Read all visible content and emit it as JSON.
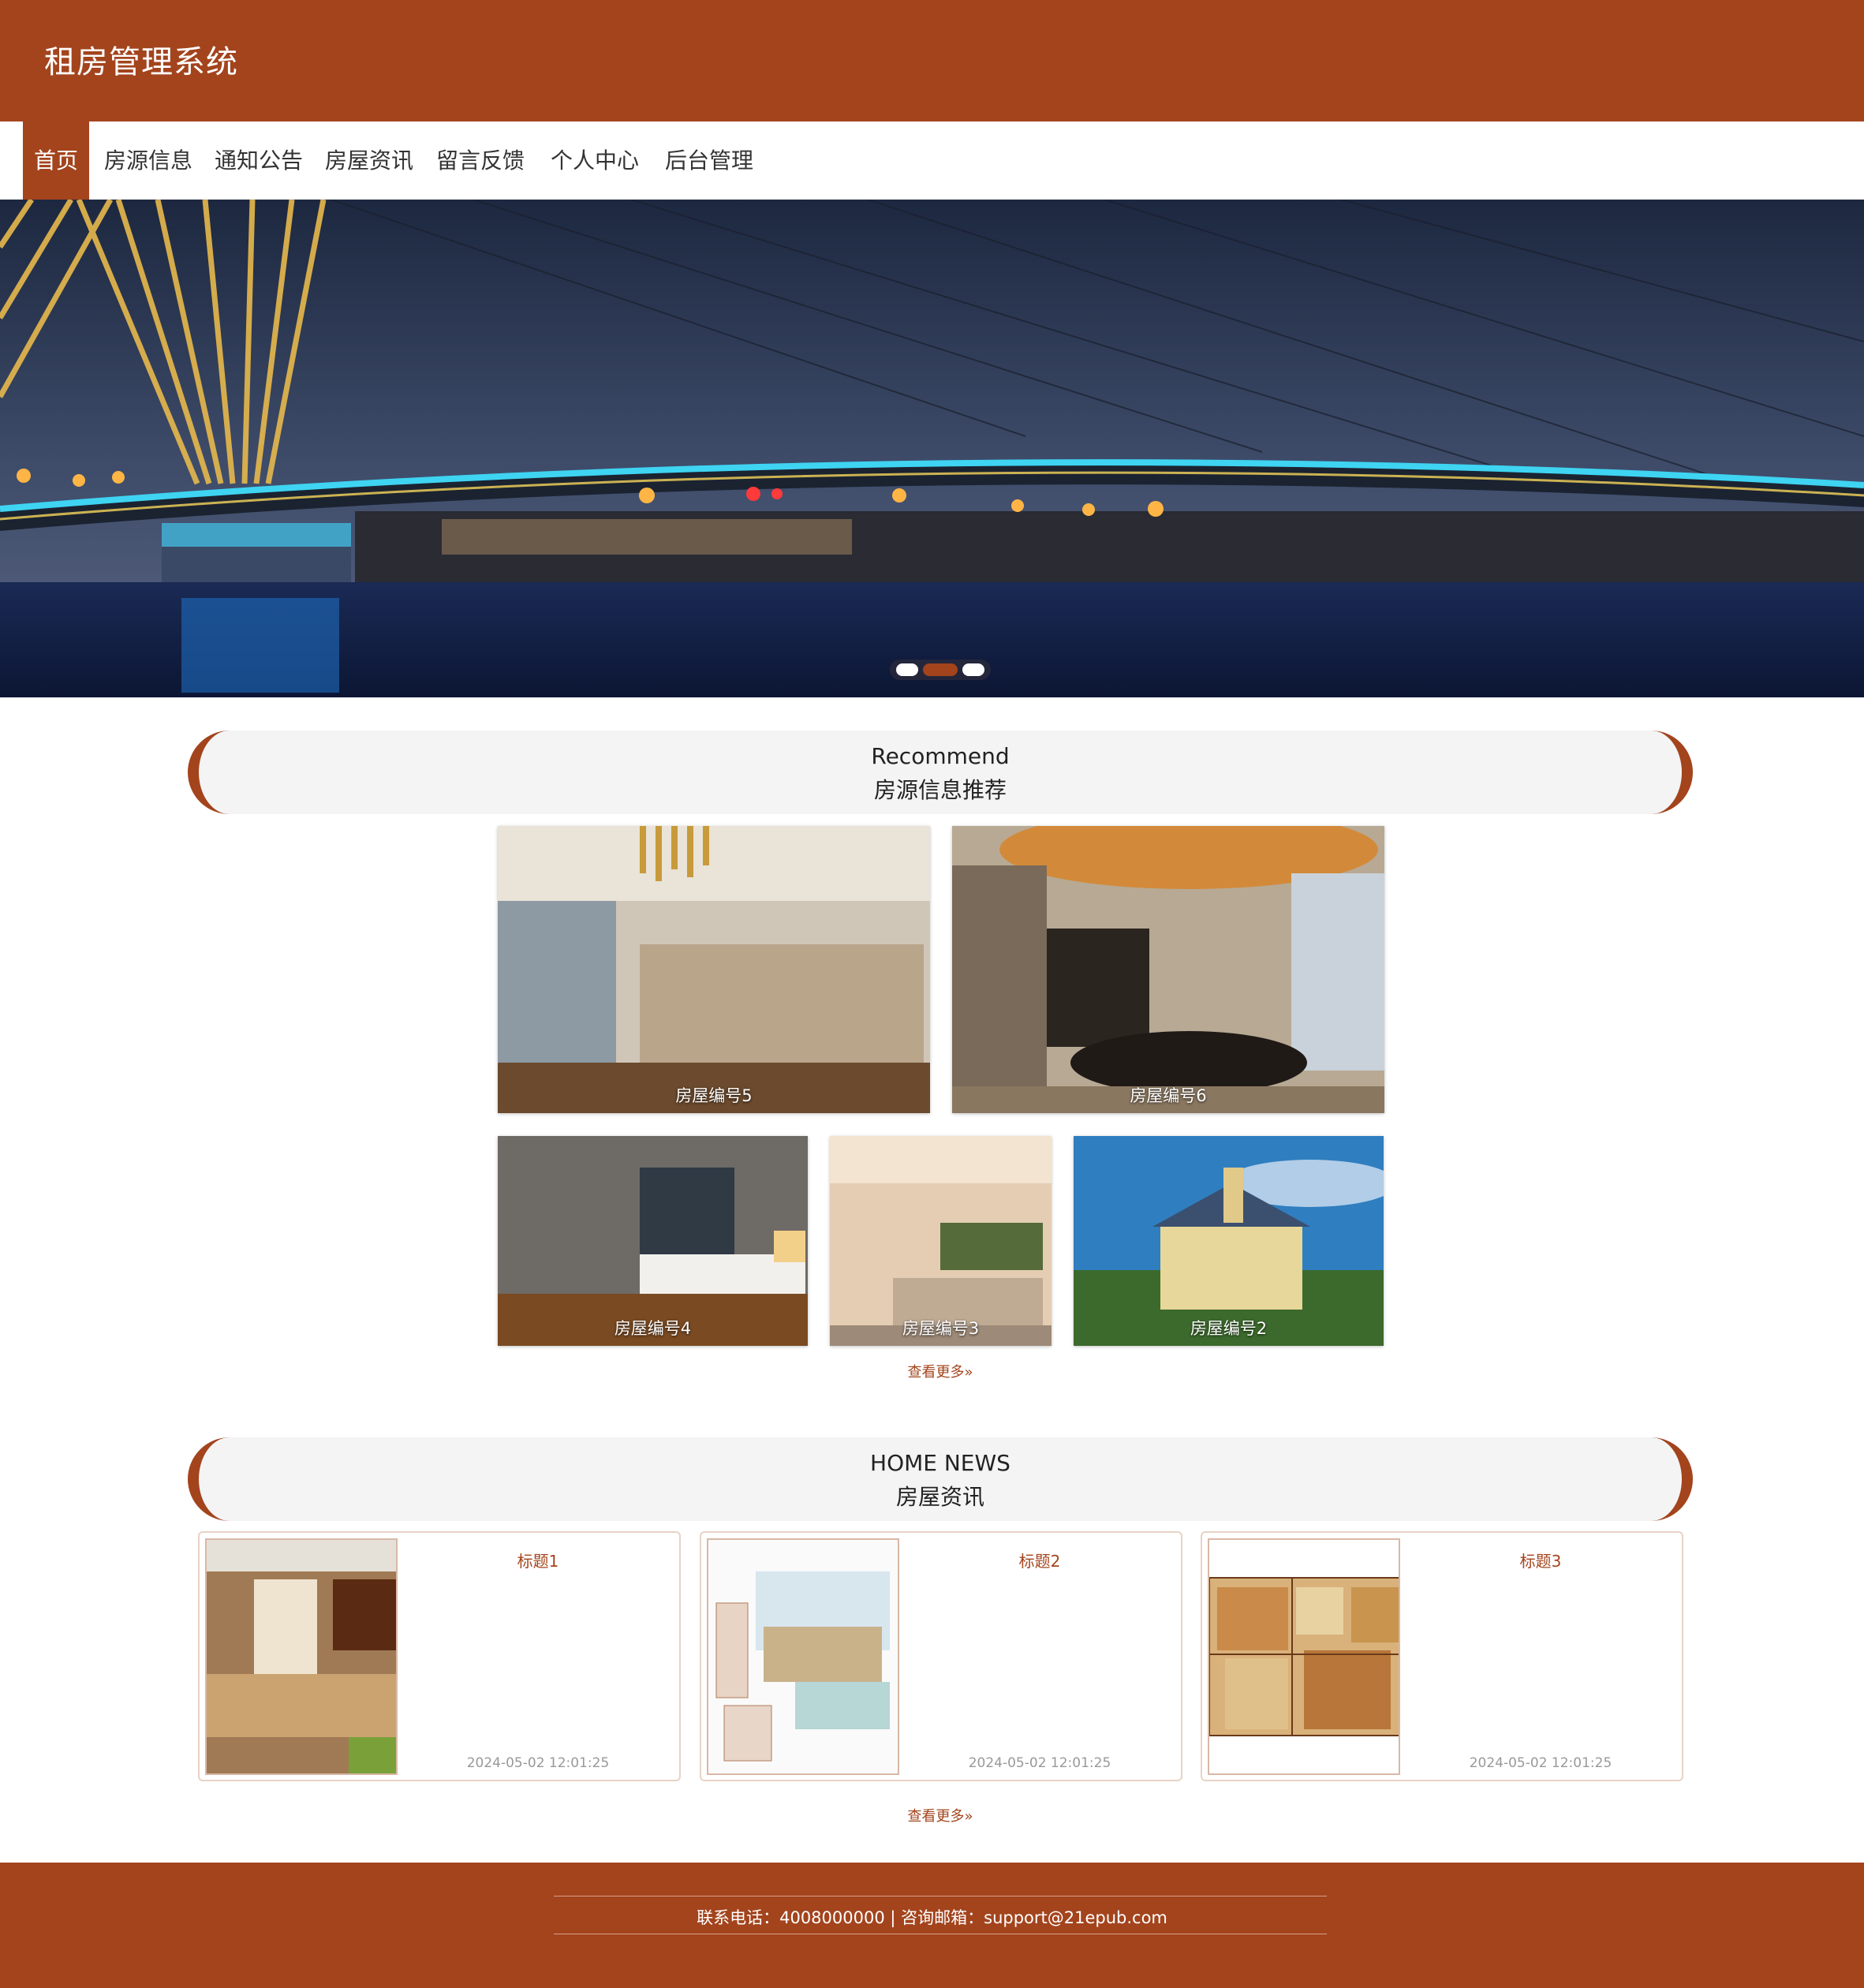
{
  "header": {
    "title": "租房管理系统"
  },
  "nav": {
    "items": [
      "首页",
      "房源信息",
      "通知公告",
      "房屋资讯",
      "留言反馈",
      "个人中心",
      "后台管理"
    ],
    "active": "首页"
  },
  "banner": {
    "slide_count": 3,
    "active_slide": 2
  },
  "recommend": {
    "heading_en": "Recommend",
    "heading_cn": "房源信息推荐",
    "items": [
      "房屋编号5",
      "房屋编号6",
      "房屋编号4",
      "房屋编号3",
      "房屋编号2"
    ],
    "more": "查看更多"
  },
  "news": {
    "heading_en": "HOME NEWS",
    "heading_cn": "房屋资讯",
    "items": [
      {
        "title": "标题1",
        "time": "2024-05-02 12:01:25"
      },
      {
        "title": "标题2",
        "time": "2024-05-02 12:01:25"
      },
      {
        "title": "标题3",
        "time": "2024-05-02 12:01:25"
      }
    ],
    "more": "查看更多"
  },
  "footer": {
    "contact": "联系电话：4008000000 | 咨询邮箱：support@21epub.com"
  },
  "colors": {
    "accent": "#a3441d",
    "panel": "#f4f4f4"
  }
}
